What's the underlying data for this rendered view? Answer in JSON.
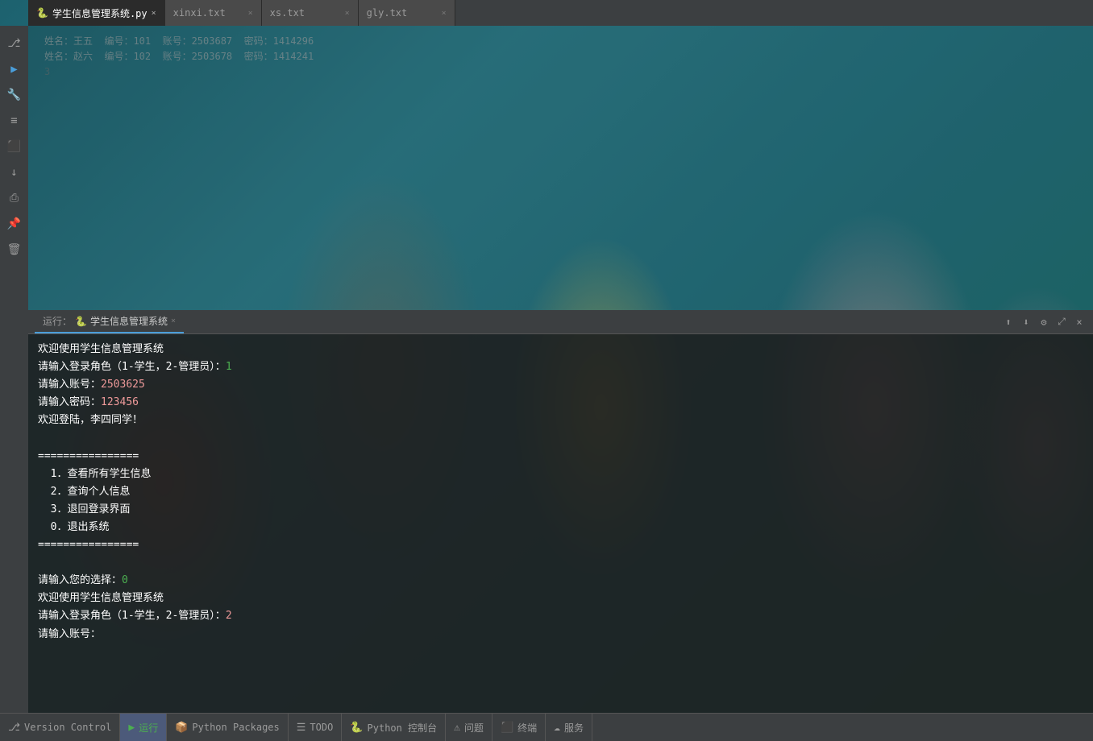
{
  "tabs": [
    {
      "id": "tab-py",
      "label": "学生信息管理系统.py",
      "type": "py",
      "active": true,
      "icon": "🐍"
    },
    {
      "id": "tab-xinxi",
      "label": "xinxi.txt",
      "type": "txt",
      "active": false
    },
    {
      "id": "tab-xs",
      "label": "xs.txt",
      "type": "txt",
      "active": false
    },
    {
      "id": "tab-gly",
      "label": "gly.txt",
      "type": "txt",
      "active": false
    }
  ],
  "code_lines": [
    {
      "num": "",
      "text": "姓名：王五  编号：101  账号：2503687  密码：1414296",
      "color": "white"
    },
    {
      "num": "",
      "text": "姓名：赵六  编号：102  账号：2503678  密码：1414241",
      "color": "white"
    },
    {
      "num": "3",
      "text": "",
      "color": "normal"
    }
  ],
  "terminal": {
    "run_label": "运行：",
    "tab_label": "🐍 学生信息管理系统",
    "lines": [
      {
        "text": "欢迎使用学生信息管理系统",
        "color": "white"
      },
      {
        "text": "请输入登录角色（1-学生，2-管理员）：",
        "color": "white",
        "suffix": "1",
        "suffix_color": "green"
      },
      {
        "text": "请输入账号：",
        "color": "white",
        "suffix": "2503625",
        "suffix_color": "red-input"
      },
      {
        "text": "请输入密码：",
        "color": "white",
        "suffix": "123456",
        "suffix_color": "red-input"
      },
      {
        "text": "欢迎登陆，李四同学！",
        "color": "white"
      },
      {
        "text": "",
        "color": "white"
      },
      {
        "text": "================",
        "color": "white"
      },
      {
        "text": "  1．查看所有学生信息",
        "color": "white"
      },
      {
        "text": "  2．查询个人信息",
        "color": "white"
      },
      {
        "text": "  3．退回登录界面",
        "color": "white"
      },
      {
        "text": "  0．退出系统",
        "color": "white"
      },
      {
        "text": "================",
        "color": "white"
      },
      {
        "text": "",
        "color": "white"
      },
      {
        "text": "请输入您的选择：",
        "color": "white",
        "suffix": "0",
        "suffix_color": "green"
      },
      {
        "text": "欢迎使用学生信息管理系统",
        "color": "white"
      },
      {
        "text": "请输入登录角色（1-学生，2-管理员）：",
        "color": "white",
        "suffix": "2",
        "suffix_color": "red-input"
      },
      {
        "text": "请输入账号：",
        "color": "white"
      }
    ]
  },
  "sidebar_icons": [
    {
      "id": "git-icon",
      "symbol": "⎇",
      "title": "Git"
    },
    {
      "id": "run-sidebar-icon",
      "symbol": "▶",
      "title": "Run"
    },
    {
      "id": "wrench-icon",
      "symbol": "🔧",
      "title": "Tools"
    },
    {
      "id": "bookmark-icon",
      "symbol": "≡",
      "title": "Bookmarks"
    },
    {
      "id": "build-icon",
      "symbol": "⬛",
      "title": "Build"
    },
    {
      "id": "download-icon",
      "symbol": "↓",
      "title": "Download"
    },
    {
      "id": "print-icon",
      "symbol": "⎙",
      "title": "Print"
    },
    {
      "id": "pin-icon",
      "symbol": "📌",
      "title": "Pin"
    },
    {
      "id": "trash-icon",
      "symbol": "🗑",
      "title": "Delete"
    }
  ],
  "status_bar": {
    "items": [
      {
        "id": "version-control",
        "icon": "⎇",
        "label": "Version Control",
        "active": false
      },
      {
        "id": "run-btn",
        "icon": "▶",
        "label": "运行",
        "active": true,
        "icon_color": "green"
      },
      {
        "id": "python-packages",
        "icon": "📦",
        "label": "Python Packages",
        "active": false
      },
      {
        "id": "todo",
        "icon": "☰",
        "label": "TODO",
        "active": false
      },
      {
        "id": "python-console",
        "icon": "🐍",
        "label": "Python 控制台",
        "active": false
      },
      {
        "id": "problems",
        "icon": "⚠",
        "label": "问题",
        "active": false
      },
      {
        "id": "terminal-btn",
        "icon": "⬛",
        "label": "终端",
        "active": false
      },
      {
        "id": "services",
        "icon": "☁",
        "label": "服务",
        "active": false
      }
    ]
  }
}
